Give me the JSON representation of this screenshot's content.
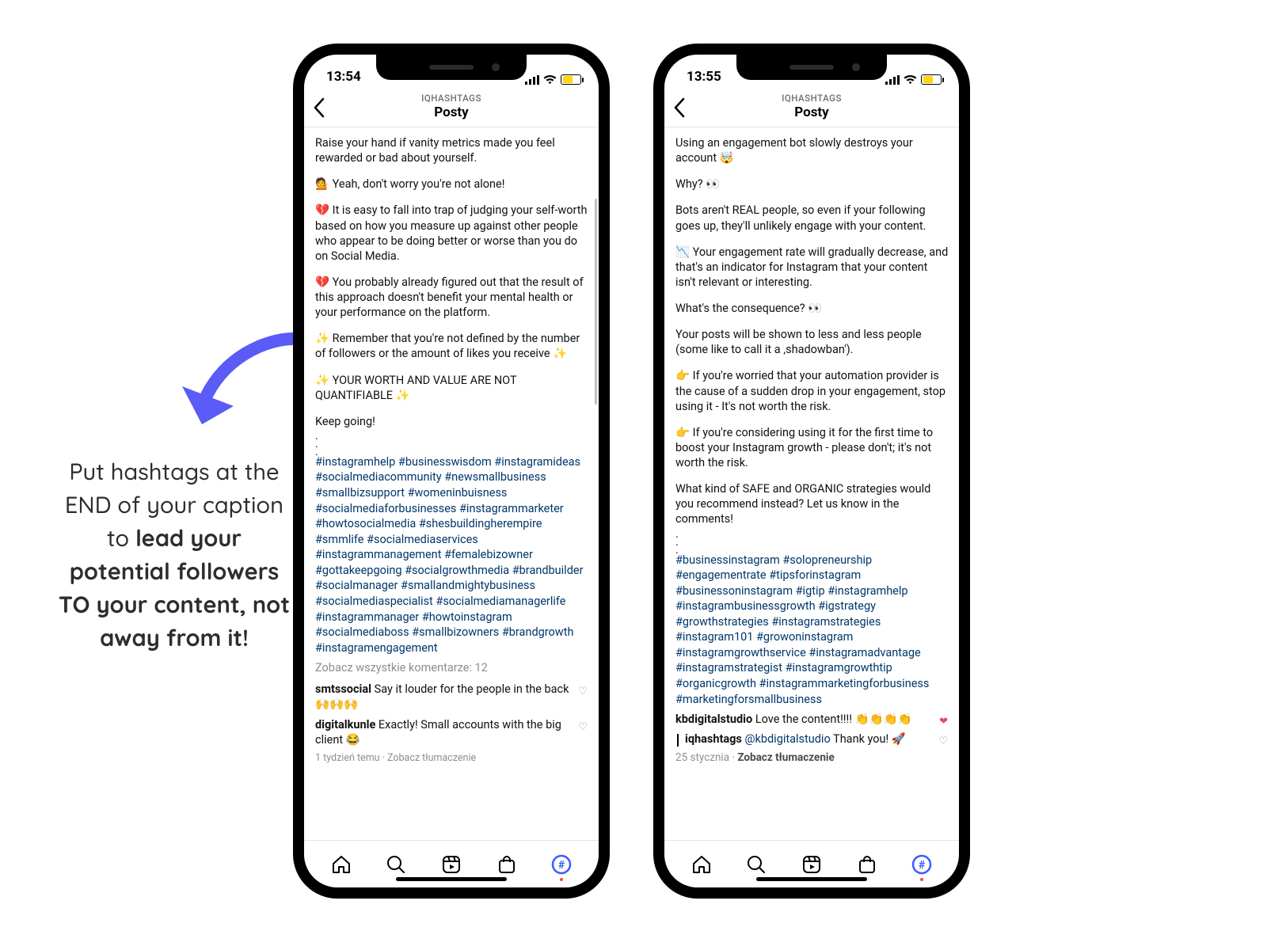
{
  "tip_text": "Put hashtags at the END of your caption to ",
  "tip_bold": "lead your potential followers TO your content, not away from it!",
  "colors": {
    "arrow": "#5b5bf7",
    "link": "#00376b",
    "battery_fill": "#ffd60a"
  },
  "phone_left": {
    "time": "13:54",
    "header_small": "IQHASHTAGS",
    "header_big": "Posty",
    "paragraphs": [
      "Raise your hand if vanity metrics made you feel rewarded or bad about yourself.",
      "💁 Yeah, don't worry you're not alone!",
      "💔 It is easy to fall into trap of judging your self-worth based on how you measure up against other people who appear to be doing better or worse than you do on Social Media.",
      "💔 You probably already figured out that the result of this approach doesn't benefit your mental health or your performance on the platform.",
      "✨ Remember that you're not defined by the number of followers or the amount of likes you receive ✨",
      "✨ YOUR WORTH AND VALUE ARE NOT QUANTIFIABLE ✨",
      "Keep going!"
    ],
    "hashtags": "#instagramhelp #businesswisdom #instagramideas #socialmediacommunity #newsmallbusiness #smallbizsupport #womeninbuisness #socialmediaforbusinesses #instagrammarketer #howtosocialmedia #shesbuildingherempire #smmlife #socialmediaservices #instagrammanagement #femalebizowner #gottakeepgoing #socialgrowthmedia #brandbuilder #socialmanager #smallandmightybusiness #socialmediaspecialist #socialmediamanagerlife #instagrammanager #howtoinstagram #socialmediaboss #smallbizowners #brandgrowth #instagramengagement",
    "comments_count_label": "Zobacz wszystkie komentarze: 12",
    "comments": [
      {
        "user": "smtssocial",
        "text": "Say it louder for the people in the back 🙌🙌🙌",
        "liked": false
      },
      {
        "user": "digitalkunle",
        "text": "Exactly! Small accounts with the big client 😂",
        "liked": false
      }
    ],
    "faded_meta": "1 tydzień temu · Zobacz tłumaczenie"
  },
  "phone_right": {
    "time": "13:55",
    "header_small": "IQHASHTAGS",
    "header_big": "Posty",
    "paragraphs": [
      "Using an engagement bot slowly destroys your account 🤯",
      "Why? 👀",
      "Bots aren't REAL people, so even if your following goes up, they'll unlikely engage with your content.",
      "📉 Your engagement rate will gradually decrease, and that's an indicator for Instagram that your content isn't relevant or interesting.",
      "What's the consequence? 👀",
      "Your posts will be shown to less and less people (some like to call it a ‚shadowban').",
      "👉 If you're worried that your automation provider is the cause of a sudden drop in your engagement, stop using it - It's not worth the risk.",
      "👉 If you're considering using it for the first time to boost your Instagram growth - please don't; it's not worth the risk.",
      "What kind of SAFE and ORGANIC strategies would you recommend instead? Let us know in the comments!"
    ],
    "hashtags": "#businessinstagram #solopreneurship #engagementrate #tipsforinstagram #businessoninstagram #igtip #instagramhelp #instagrambusinessgrowth #igstrategy #growthstrategies #instagramstrategies #instagram101 #growoninstagram #instagramgrowthservice #instagramadvantage #instagramstrategist #instagramgrowthtip #organicgrowth #instagrammarketingforbusiness #marketingforsmallbusiness",
    "comments": [
      {
        "user": "kbdigitalstudio",
        "text": "Love the content!!!! 👏👏👏👏",
        "liked": true
      },
      {
        "user": "iqhashtags",
        "mention": "@kbdigitalstudio",
        "text": "Thank you! 🚀",
        "liked": false,
        "is_reply": true
      }
    ],
    "meta": {
      "date": "25 stycznia",
      "translate": "Zobacz tłumaczenie"
    }
  },
  "nav_icons": [
    "home",
    "search",
    "reels",
    "shop",
    "hashtag"
  ]
}
